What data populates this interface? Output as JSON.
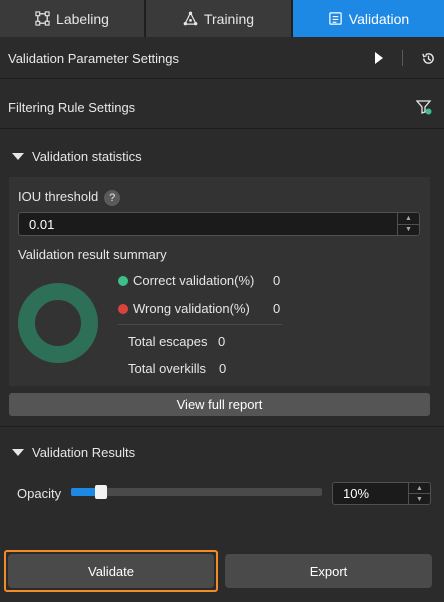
{
  "tabs": [
    {
      "label": "Labeling",
      "icon": "labeling-icon"
    },
    {
      "label": "Training",
      "icon": "training-icon"
    },
    {
      "label": "Validation",
      "icon": "validation-icon"
    }
  ],
  "active_tab": "Validation",
  "validation_param_settings": {
    "title": "Validation Parameter Settings"
  },
  "filtering_rule_settings": {
    "title": "Filtering Rule Settings"
  },
  "stats": {
    "title": "Validation statistics",
    "iou_label": "IOU threshold",
    "iou_help": "?",
    "iou_value": "0.01",
    "summary_title": "Validation result summary",
    "correct_label": "Correct validation(%)",
    "correct_value": "0",
    "wrong_label": "Wrong validation(%)",
    "wrong_value": "0",
    "escapes_label": "Total escapes",
    "escapes_value": "0",
    "overkills_label": "Total overkills",
    "overkills_value": "0",
    "correct_color": "#3dbf8a",
    "wrong_color": "#d9443a",
    "donut_color": "#2e6f57",
    "report_button": "View full report"
  },
  "results": {
    "title": "Validation Results",
    "opacity_label": "Opacity",
    "opacity_value": "10%",
    "opacity_fraction": 0.1
  },
  "footer": {
    "validate_label": "Validate",
    "export_label": "Export"
  },
  "colors": {
    "accent": "#1e88e5",
    "highlight": "#f28c28"
  }
}
